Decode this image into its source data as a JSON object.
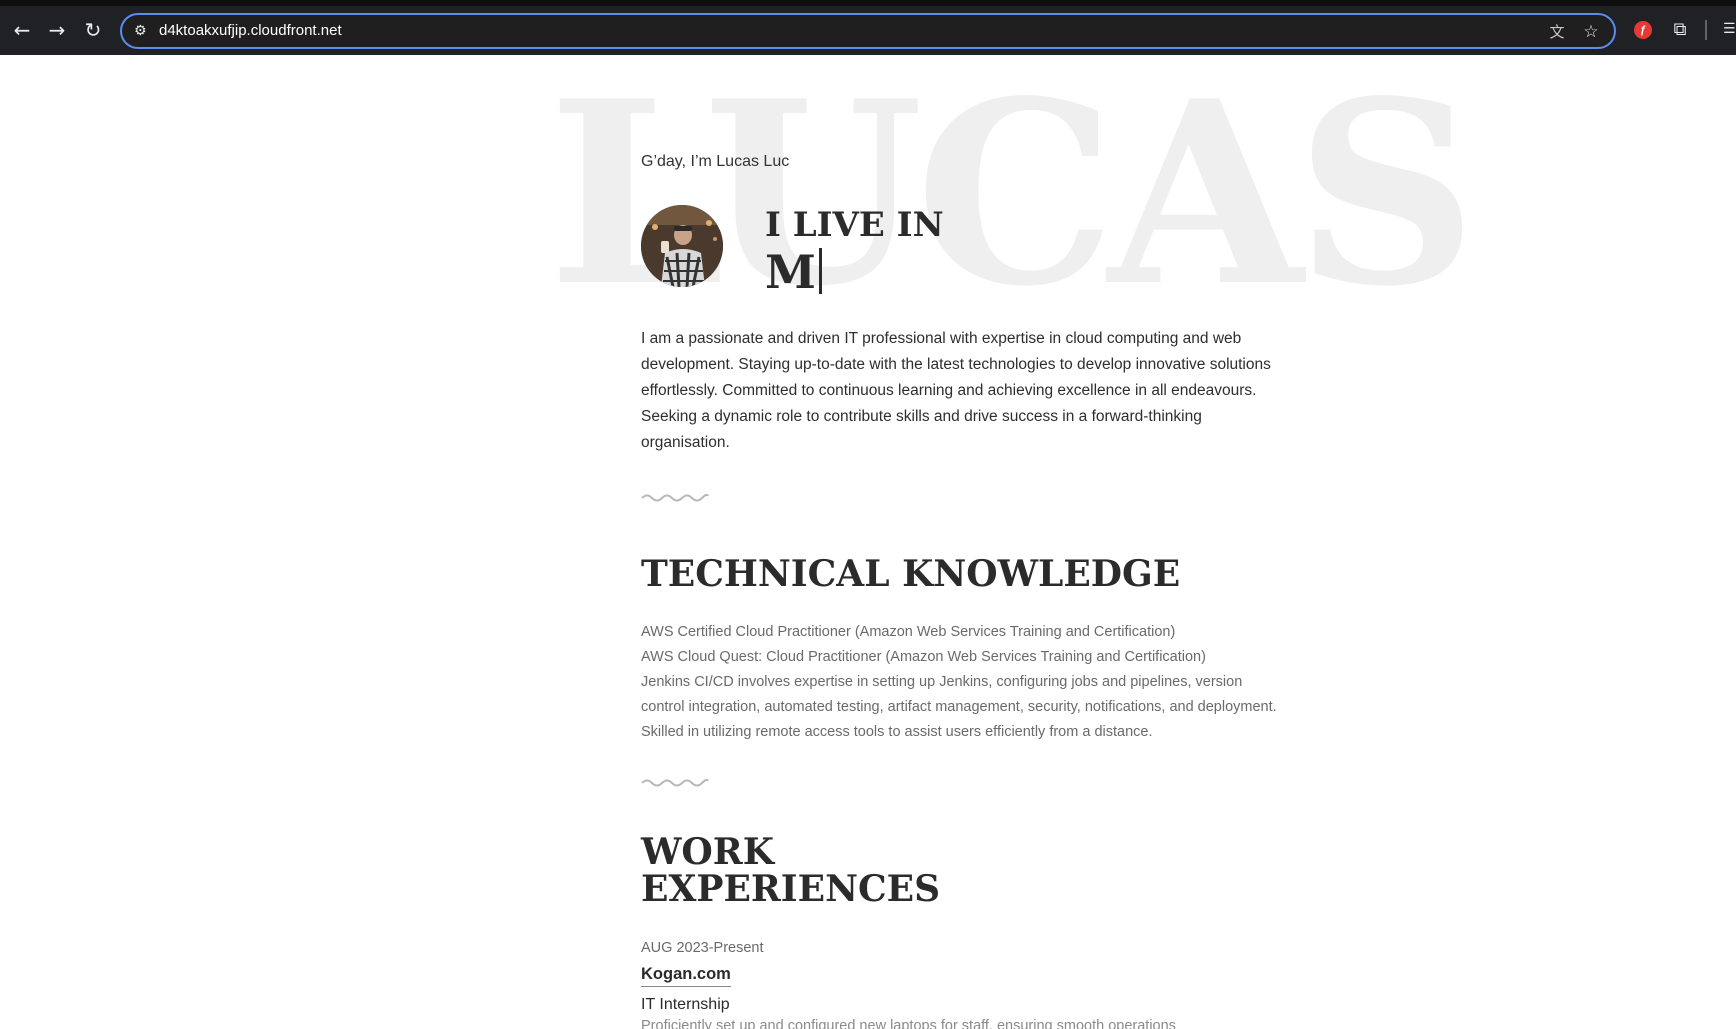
{
  "browser": {
    "url": "d4ktoakxufjip.cloudfront.net",
    "icons": {
      "back": "back-arrow-icon",
      "forward": "forward-arrow-icon",
      "reload": "reload-icon",
      "site_info": "tune-icon",
      "translate": "translate-icon",
      "bookmark": "star-icon",
      "extension_red": "extension-icon",
      "extensions": "puzzle-icon",
      "side_panel": "side-panel-icon"
    }
  },
  "hero": {
    "background_word": "LUCAS",
    "greeting": "G’day, I’m Lucas Luc",
    "live_in_label": "I LIVE IN",
    "typed_text": "M",
    "intro": "I am a passionate and driven IT professional with expertise in cloud computing and web development. Staying up-to-date with the latest technologies to develop innovative solutions effortlessly. Committed to continuous learning and achieving excellence in all endeavours. Seeking a dynamic role to contribute skills and drive success in a forward-thinking organisation."
  },
  "technical": {
    "title": "TECHNICAL KNOWLEDGE",
    "items": [
      "AWS Certified Cloud Practitioner (Amazon Web Services Training and Certification)",
      "AWS Cloud Quest: Cloud Practitioner (Amazon Web Services Training and Certification)",
      "Jenkins CI/CD involves expertise in setting up Jenkins, configuring jobs and pipelines, version control integration, automated testing, artifact management, security, notifications, and deployment.",
      "Skilled in utilizing remote access tools to assist users efficiently from a distance."
    ]
  },
  "work": {
    "title_line1": "WORK",
    "title_line2": "EXPERIENCES",
    "jobs": [
      {
        "date": "AUG 2023-Present",
        "company": "Kogan.com",
        "role": "IT Internship",
        "desc": "Proficiently set up and configured new laptops for staff, ensuring smooth operations"
      }
    ]
  },
  "colors": {
    "chrome_bg": "#202124",
    "omnibox_border": "#5b8def",
    "heading": "#2b2b2b",
    "bg_word": "#efefef"
  }
}
